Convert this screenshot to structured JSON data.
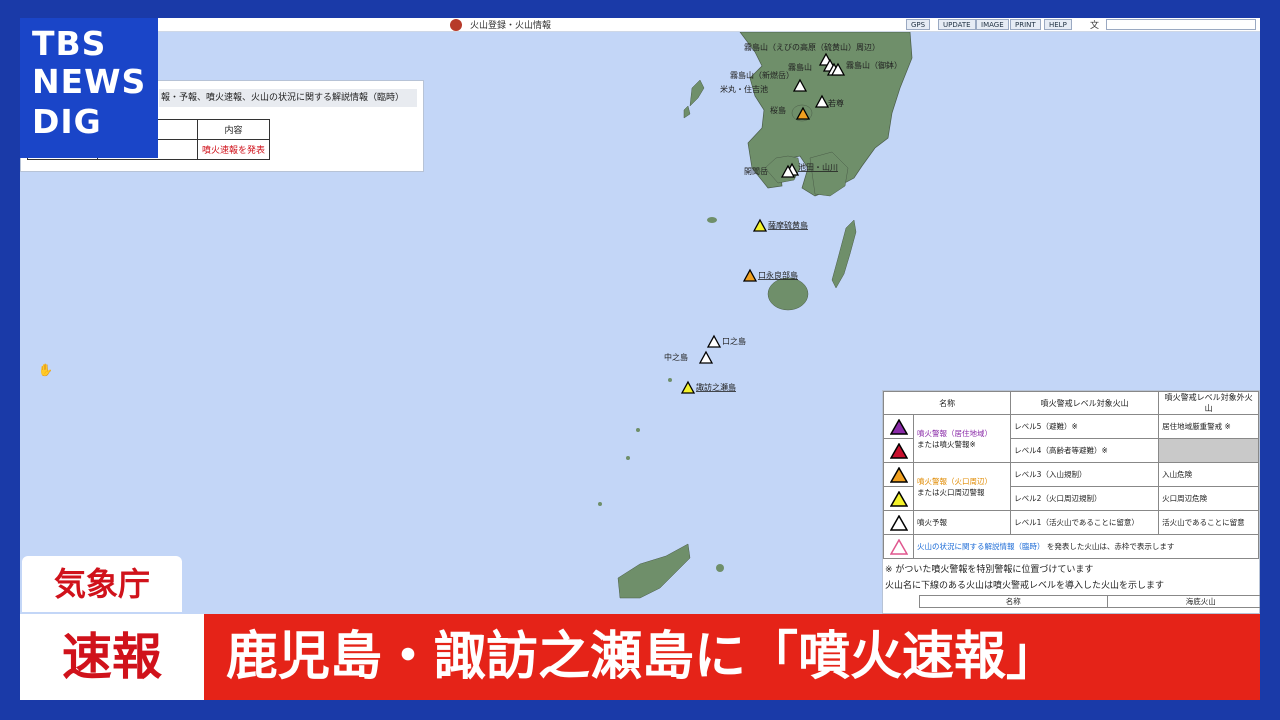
{
  "channel": {
    "logo_lines": [
      "TBS",
      "NEWS",
      "DIG"
    ]
  },
  "toolbar": {
    "title": "火山登録・火山情報",
    "buttons": [
      "GPS",
      "UPDATE",
      "IMAGE",
      "PRINT",
      "HELP"
    ]
  },
  "infobox": {
    "header": "報・予報、噴火速報、火山の状況に関する解説情報（臨時）",
    "col_header": "内容",
    "value": "噴火速報を発表"
  },
  "volcanoes": [
    {
      "name": "霧島山（えびの高原（硫黄山）周辺）",
      "level_color": "white"
    },
    {
      "name": "霧島山",
      "level_color": "white"
    },
    {
      "name": "霧島山（新燃岳）",
      "level_color": "white"
    },
    {
      "name": "霧島山（御鉢）",
      "level_color": "white"
    },
    {
      "name": "米丸・住吉池",
      "level_color": "white"
    },
    {
      "name": "若尊",
      "level_color": "white"
    },
    {
      "name": "桜島",
      "level_color": "orange"
    },
    {
      "name": "池田・山川",
      "level_color": "white"
    },
    {
      "name": "開聞岳",
      "level_color": "white"
    },
    {
      "name": "薩摩硫黄島",
      "level_color": "yellow"
    },
    {
      "name": "口永良部島",
      "level_color": "orange"
    },
    {
      "name": "口之島",
      "level_color": "white"
    },
    {
      "name": "中之島",
      "level_color": "white"
    },
    {
      "name": "諏訪之瀬島",
      "level_color": "yellow"
    }
  ],
  "legend": {
    "headers": [
      "名称",
      "噴火警戒レベル対象火山",
      "噴火警戒レベル対象外火山"
    ],
    "rows": [
      {
        "name": "噴火警報（居住地域）",
        "name2": "または噴火警報※",
        "level": "レベル5（避難）※",
        "other": "居住地域厳重警戒 ※"
      },
      {
        "level": "レベル4（高齢者等避難）※",
        "other": ""
      },
      {
        "name": "噴火警報（火口周辺）",
        "name2": "または火口周辺警報",
        "level": "レベル3（入山規制）",
        "other": "入山危険"
      },
      {
        "level": "レベル2（火口周辺規制）",
        "other": "火口周辺危険"
      },
      {
        "name": "噴火予報",
        "level": "レベル1（活火山であることに留意）",
        "other": "活火山であることに留意"
      },
      {
        "name": "火山の状況に関する解説情報（臨時）",
        "rest": "を発表した火山は、赤枠で表示します"
      }
    ],
    "note1": "※ がついた噴火警報を特別警報に位置づけています",
    "note2": "火山名に下線のある火山は噴火警戒レベルを導入した火山を示します",
    "sub_headers": [
      "名称",
      "海底火山"
    ],
    "colors": {
      "purple": "#8a2aa8",
      "red": "#c8102e",
      "orange": "#f0a020",
      "yellow": "#f4f22a",
      "white": "#ffffff",
      "pink": "#e0568e"
    }
  },
  "overlay": {
    "source": "気象庁",
    "badge": "速報",
    "headline": "鹿児島・諏訪之瀬島に「噴火速報」"
  }
}
